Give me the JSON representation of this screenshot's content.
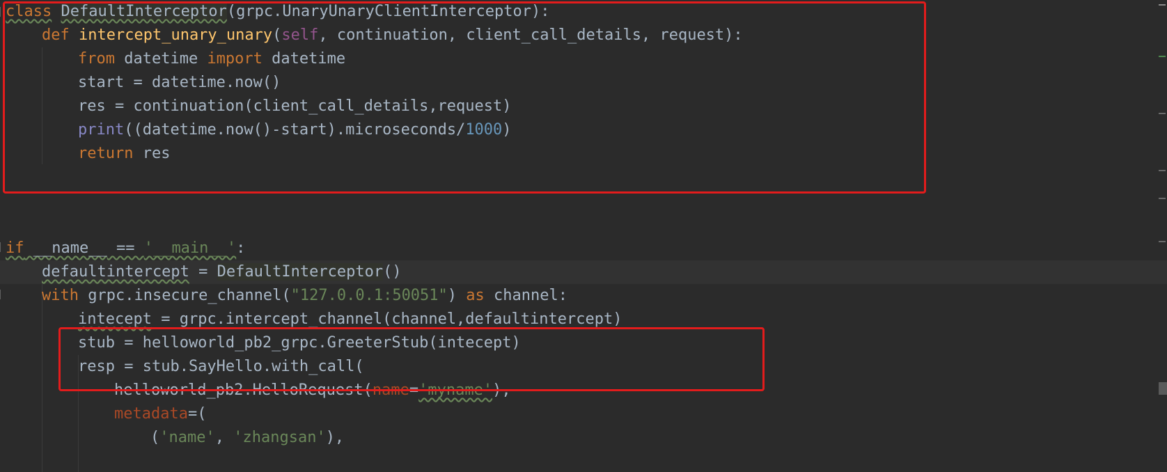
{
  "colors": {
    "background": "#2b2b2b",
    "keyword": "#cc7832",
    "function": "#ffc66d",
    "self": "#94558d",
    "number": "#6897bb",
    "string": "#6a8759",
    "builtin": "#8888c6",
    "param": "#aa4926",
    "default_text": "#a9b7c6",
    "highlight_box": "#e31c1c"
  },
  "code": {
    "l1": {
      "kw_class": "class",
      "class_name": "DefaultInterceptor",
      "rest": "(grpc.UnaryUnaryClientInterceptor):"
    },
    "l2": {
      "kw_def": "def",
      "func_name": "intercept_unary_unary",
      "p_open": "(",
      "self": "self",
      "params": ", continuation, client_call_details, request):"
    },
    "l3": {
      "kw_from": "from",
      "mod": " datetime ",
      "kw_import": "import",
      "name": " datetime"
    },
    "l4": {
      "text": "start = datetime.now()"
    },
    "l5": {
      "text": "res = continuation(client_call_details,request)"
    },
    "l6": {
      "print": "print",
      "expr": "((datetime.now()-start).microseconds/",
      "num": "1000",
      "close": ")"
    },
    "l7": {
      "kw_return": "return",
      "name": " res"
    },
    "l8": {
      "kw_if": "if",
      "name": " __name__",
      "op": " == ",
      "str": "'__main__'",
      "colon": ":"
    },
    "l9": {
      "var": "defaultintercept",
      "op": " = ",
      "cls": "DefaultInterceptor",
      "call": "()"
    },
    "l10": {
      "kw_with": "with",
      "call": " grpc.insecure_channel(",
      "str": "\"127.0.0.1:50051\"",
      "close": ") ",
      "kw_as": "as",
      "name": " channel:"
    },
    "l11": {
      "var": "intecept",
      "rest": " = grpc.intercept_channel(channel,defaultintercept)"
    },
    "l12": {
      "text": "stub = helloworld_pb2_grpc.GreeterStub(intecept)"
    },
    "l13": {
      "text": "resp = stub.SayHello.with_call("
    },
    "l14": {
      "call": "helloworld_pb2.HelloRequest(",
      "param": "name",
      "eq": "=",
      "str": "'myname'",
      "close": "),"
    },
    "l15": {
      "param": "metadata",
      "rest": "=("
    },
    "l16": {
      "open": "(",
      "str1": "'name'",
      "comma": ", ",
      "str2": "'zhangsan'",
      "close": "),"
    }
  }
}
